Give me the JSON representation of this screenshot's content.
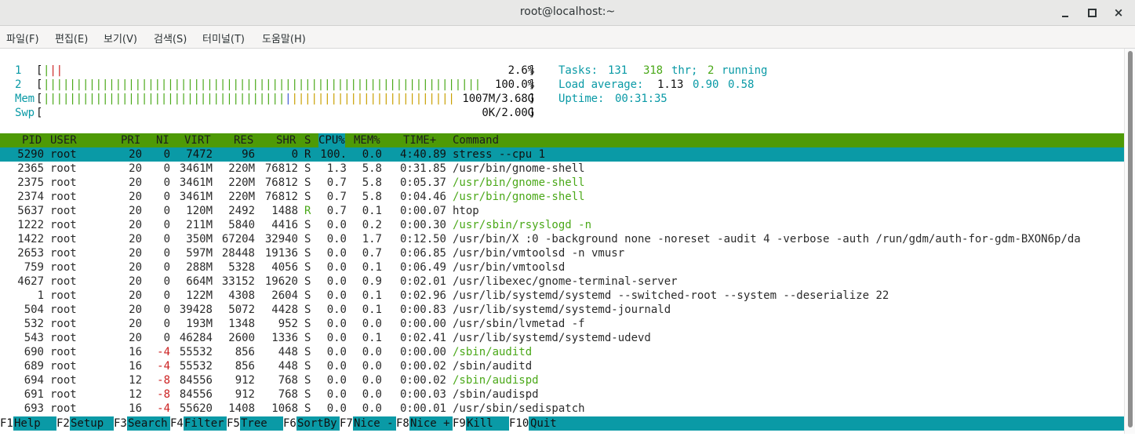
{
  "window": {
    "title": "root@localhost:~"
  },
  "menu": [
    "파일(F)",
    "편집(E)",
    "보기(V)",
    "검색(S)",
    "터미널(T)",
    "도움말(H)"
  ],
  "meters": {
    "cpu1": {
      "label": "1",
      "value": "2.6%"
    },
    "cpu2": {
      "label": "2",
      "value": "100.0%"
    },
    "mem": {
      "label": "Mem",
      "value": "1007M/3.68G"
    },
    "swp": {
      "label": "Swp",
      "value": "0K/2.00G"
    }
  },
  "summary": {
    "tasks_label": "Tasks:",
    "tasks": "131",
    "threads": "318",
    "thr_label": "thr;",
    "running": "2",
    "running_label": "running",
    "load_label": "Load average:",
    "load1": "1.13",
    "load5": "0.90",
    "load15": "0.58",
    "uptime_label": "Uptime:",
    "uptime": "00:31:35"
  },
  "header": [
    "PID",
    "USER",
    "PRI",
    "NI",
    "VIRT",
    "RES",
    "SHR",
    "S",
    "CPU%",
    "MEM%",
    "TIME+",
    "Command"
  ],
  "processes": [
    [
      "5290",
      "root",
      "20",
      "0",
      "7472",
      "96",
      "0",
      "R",
      "100.",
      "0.0",
      "4:40.89",
      "stress --cpu 1"
    ],
    [
      "2365",
      "root",
      "20",
      "0",
      "3461M",
      "220M",
      "76812",
      "S",
      "1.3",
      "5.8",
      "0:31.85",
      "/usr/bin/gnome-shell"
    ],
    [
      "2375",
      "root",
      "20",
      "0",
      "3461M",
      "220M",
      "76812",
      "S",
      "0.7",
      "5.8",
      "0:05.37",
      "/usr/bin/gnome-shell"
    ],
    [
      "2374",
      "root",
      "20",
      "0",
      "3461M",
      "220M",
      "76812",
      "S",
      "0.7",
      "5.8",
      "0:04.46",
      "/usr/bin/gnome-shell"
    ],
    [
      "5637",
      "root",
      "20",
      "0",
      "120M",
      "2492",
      "1488",
      "R",
      "0.7",
      "0.1",
      "0:00.07",
      "htop"
    ],
    [
      "1222",
      "root",
      "20",
      "0",
      "211M",
      "5840",
      "4416",
      "S",
      "0.0",
      "0.2",
      "0:00.30",
      "/usr/sbin/rsyslogd -n"
    ],
    [
      "1422",
      "root",
      "20",
      "0",
      "350M",
      "67204",
      "32940",
      "S",
      "0.0",
      "1.7",
      "0:12.50",
      "/usr/bin/X :0 -background none -noreset -audit 4 -verbose -auth /run/gdm/auth-for-gdm-BXON6p/da"
    ],
    [
      "2653",
      "root",
      "20",
      "0",
      "597M",
      "28448",
      "19136",
      "S",
      "0.0",
      "0.7",
      "0:06.85",
      "/usr/bin/vmtoolsd -n vmusr"
    ],
    [
      "759",
      "root",
      "20",
      "0",
      "288M",
      "5328",
      "4056",
      "S",
      "0.0",
      "0.1",
      "0:06.49",
      "/usr/bin/vmtoolsd"
    ],
    [
      "4627",
      "root",
      "20",
      "0",
      "664M",
      "33152",
      "19620",
      "S",
      "0.0",
      "0.9",
      "0:02.01",
      "/usr/libexec/gnome-terminal-server"
    ],
    [
      "1",
      "root",
      "20",
      "0",
      "122M",
      "4308",
      "2604",
      "S",
      "0.0",
      "0.1",
      "0:02.96",
      "/usr/lib/systemd/systemd --switched-root --system --deserialize 22"
    ],
    [
      "504",
      "root",
      "20",
      "0",
      "39428",
      "5072",
      "4428",
      "S",
      "0.0",
      "0.1",
      "0:00.83",
      "/usr/lib/systemd/systemd-journald"
    ],
    [
      "532",
      "root",
      "20",
      "0",
      "193M",
      "1348",
      "952",
      "S",
      "0.0",
      "0.0",
      "0:00.00",
      "/usr/sbin/lvmetad -f"
    ],
    [
      "543",
      "root",
      "20",
      "0",
      "46284",
      "2600",
      "1336",
      "S",
      "0.0",
      "0.1",
      "0:02.41",
      "/usr/lib/systemd/systemd-udevd"
    ],
    [
      "690",
      "root",
      "16",
      "-4",
      "55532",
      "856",
      "448",
      "S",
      "0.0",
      "0.0",
      "0:00.00",
      "/sbin/auditd"
    ],
    [
      "689",
      "root",
      "16",
      "-4",
      "55532",
      "856",
      "448",
      "S",
      "0.0",
      "0.0",
      "0:00.02",
      "/sbin/auditd"
    ],
    [
      "694",
      "root",
      "12",
      "-8",
      "84556",
      "912",
      "768",
      "S",
      "0.0",
      "0.0",
      "0:00.02",
      "/sbin/audispd"
    ],
    [
      "691",
      "root",
      "12",
      "-8",
      "84556",
      "912",
      "768",
      "S",
      "0.0",
      "0.0",
      "0:00.03",
      "/sbin/audispd"
    ],
    [
      "693",
      "root",
      "16",
      "-4",
      "55620",
      "1408",
      "1068",
      "S",
      "0.0",
      "0.0",
      "0:00.01",
      "/usr/sbin/sedispatch"
    ]
  ],
  "function_keys": [
    {
      "key": "F1",
      "label": "Help"
    },
    {
      "key": "F2",
      "label": "Setup"
    },
    {
      "key": "F3",
      "label": "Search"
    },
    {
      "key": "F4",
      "label": "Filter"
    },
    {
      "key": "F5",
      "label": "Tree"
    },
    {
      "key": "F6",
      "label": "SortBy"
    },
    {
      "key": "F7",
      "label": "Nice -"
    },
    {
      "key": "F8",
      "label": "Nice +"
    },
    {
      "key": "F9",
      "label": "Kill"
    },
    {
      "key": "F10",
      "label": "Quit"
    }
  ],
  "colors": {
    "cyan": "#0a9aa6",
    "green": "#4e9a06",
    "red": "#cc2222",
    "yellow": "#c9a000"
  }
}
